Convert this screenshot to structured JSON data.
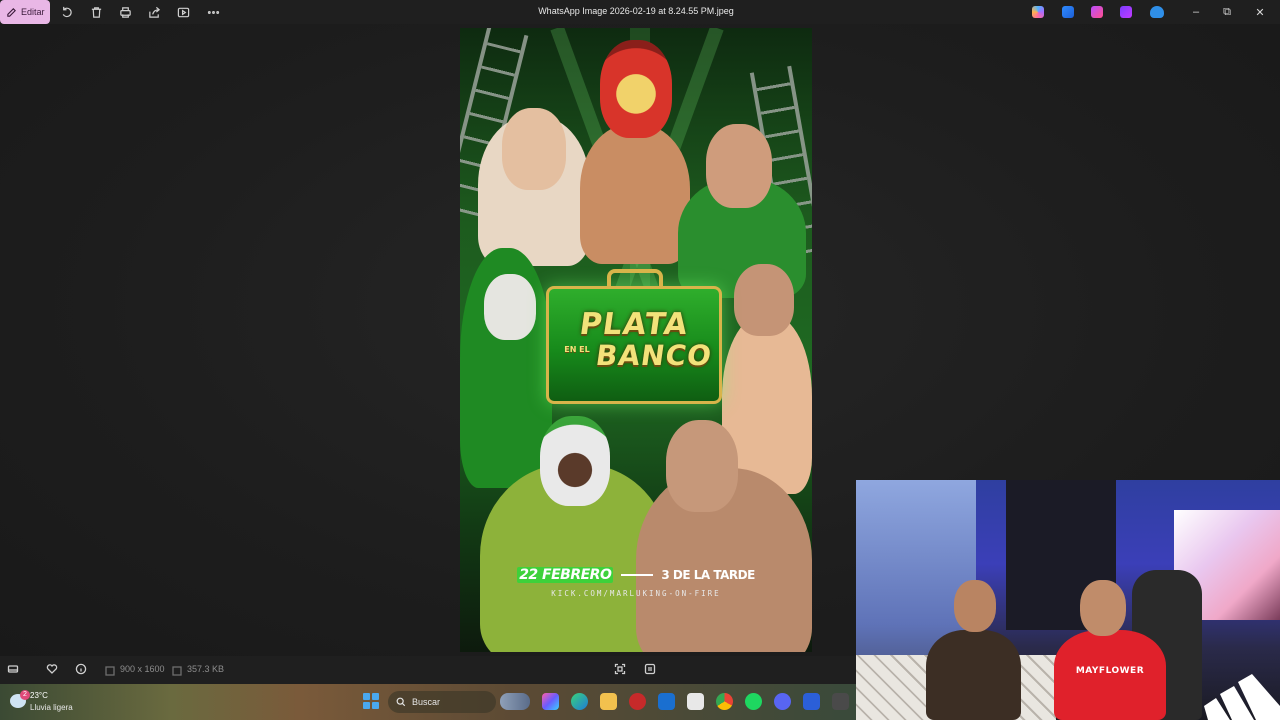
{
  "window": {
    "title": "WhatsApp Image 2026-02-19 at 8.24.55 PM.jpeg",
    "edit_label": "Editar",
    "toolbar_icons": [
      "edit-icon",
      "rotate-icon",
      "delete-icon",
      "print-icon",
      "share-icon",
      "slideshow-icon",
      "more-icon"
    ],
    "tray_apps": [
      "copilot-icon",
      "clipchamp-icon",
      "designer-icon",
      "clipchamp-video-icon",
      "onedrive-icon"
    ],
    "controls": {
      "minimize": "–",
      "restore": "⧉",
      "close": "✕"
    }
  },
  "poster": {
    "title_line1": "PLATA",
    "title_small": "EN EL",
    "title_line2": "BANCO",
    "date": "22 FEBRERO",
    "time": "3 DE LA TARDE",
    "url": "KICK.COM/MARLUKING-ON-FIRE",
    "colors": {
      "green": "#3ed13a",
      "gold": "#f2e27a"
    }
  },
  "statusbar": {
    "dimensions": "900 x 1600",
    "file_size": "357.3 KB"
  },
  "taskbar": {
    "weather_temp": "23°C",
    "weather_condition": "Lluvia ligera",
    "weather_badge": "2",
    "search_placeholder": "Buscar"
  },
  "webcam": {
    "shirt_text": "MAYFLOWER"
  }
}
